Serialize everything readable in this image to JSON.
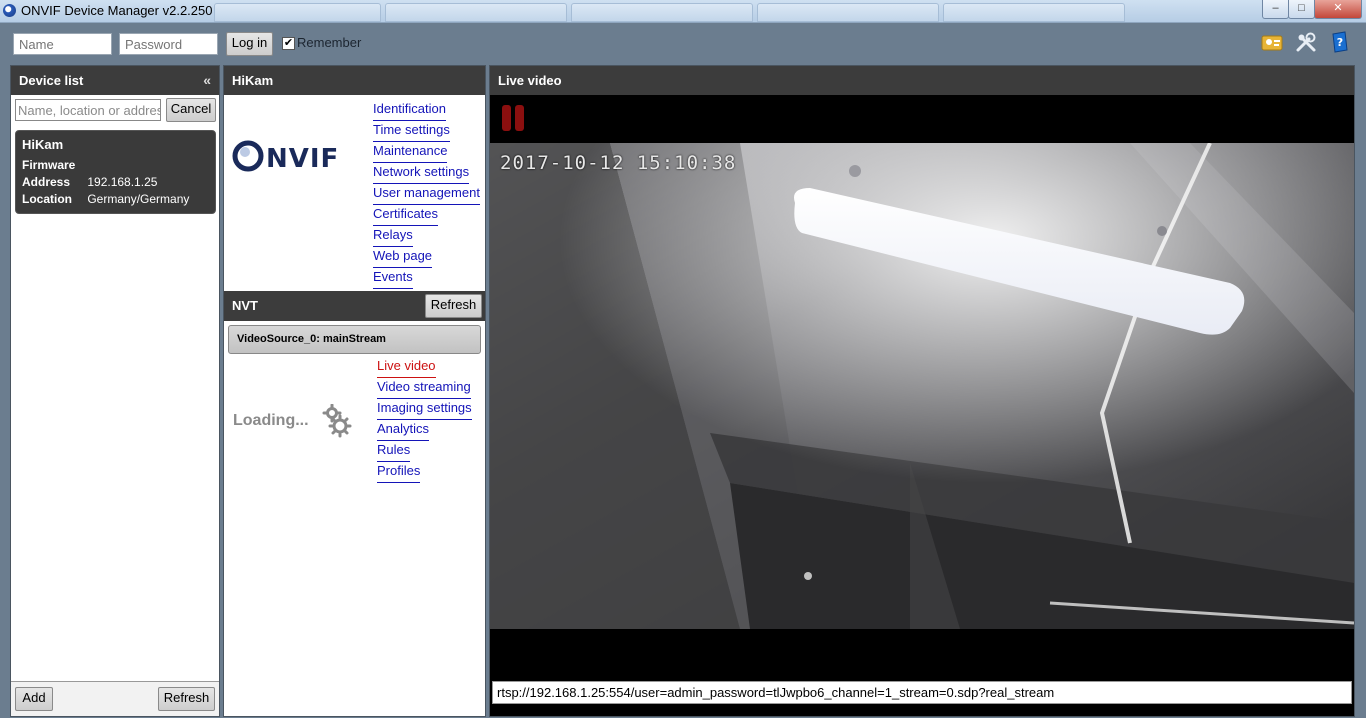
{
  "window": {
    "title": "ONVIF Device Manager v2.2.250",
    "controls": {
      "minimize": "–",
      "maximize": "□",
      "close": "✕"
    }
  },
  "login": {
    "name_placeholder": "Name",
    "password_placeholder": "Password",
    "login_label": "Log in",
    "remember_label": "Remember",
    "remember_checked": true
  },
  "toolbar": {
    "icons": [
      "account-icon",
      "settings-tools-icon",
      "help-book-icon"
    ]
  },
  "device_list": {
    "title": "Device list",
    "collapse_glyph": "«",
    "search_placeholder": "Name, location or address",
    "cancel_label": "Cancel",
    "device": {
      "name": "HiKam",
      "firmware_label": "Firmware",
      "firmware_value": "",
      "address_label": "Address",
      "address_value": "192.168.1.25",
      "location_label": "Location",
      "location_value": "Germany/Germany"
    },
    "add_label": "Add",
    "refresh_label": "Refresh"
  },
  "device_panel": {
    "title": "HiKam",
    "logo_text": "ONVIF",
    "links": [
      "Identification",
      "Time settings",
      "Maintenance",
      "Network settings",
      "User management",
      "Certificates",
      "Relays",
      "Web page",
      "Events"
    ],
    "nvt_label": "NVT",
    "refresh_label": "Refresh",
    "source_label": "VideoSource_0: mainStream",
    "loading_label": "Loading...",
    "source_links": [
      "Live video",
      "Video streaming",
      "Imaging settings",
      "Analytics",
      "Rules",
      "Profiles"
    ],
    "active_source_link": "Live video"
  },
  "live_video": {
    "title": "Live video",
    "timestamp": "2017-10-12 15:10:38",
    "stream_url": "rtsp://192.168.1.25:554/user=admin_password=tlJwpbo6_channel=1_stream=0.sdp?real_stream"
  },
  "colors": {
    "link": "#1414b8",
    "active_link": "#cc1111",
    "header_bg": "#3c3c3c",
    "app_bg": "#6b7d8f"
  }
}
